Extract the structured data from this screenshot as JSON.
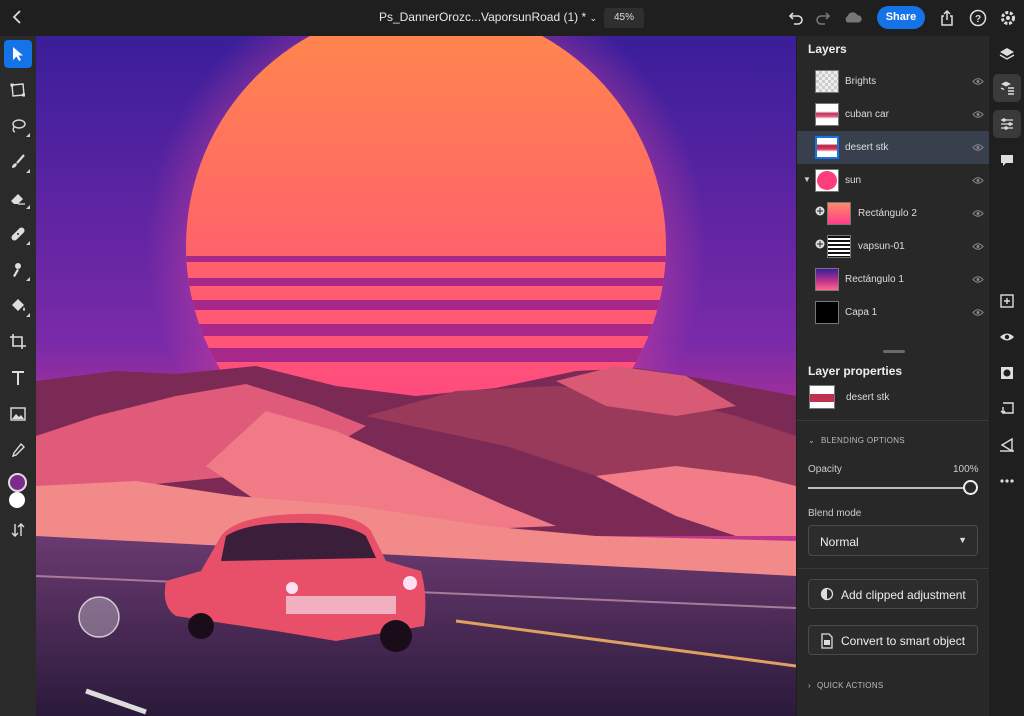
{
  "header": {
    "document_title": "Ps_DannerOrozc...VaporsunRoad (1) *",
    "zoom": "45%",
    "share_label": "Share"
  },
  "colors": {
    "accent": "#1473e6",
    "foreground_color": "#7d2a8c",
    "background_color": "#ffffff"
  },
  "toolbar": {
    "tools": [
      "move-tool",
      "transform-tool",
      "lasso-tool",
      "brush-tool",
      "eraser-tool",
      "healing-tool",
      "clone-stamp-tool",
      "paint-bucket-tool",
      "crop-tool",
      "type-tool",
      "place-image-tool",
      "eyedropper-tool",
      "color-swatches",
      "swap-colors"
    ]
  },
  "layers_panel": {
    "title": "Layers",
    "layers": [
      {
        "name": "Brights"
      },
      {
        "name": "cuban car"
      },
      {
        "name": "desert stk",
        "selected": true
      },
      {
        "name": "sun",
        "group": true,
        "expanded": true
      },
      {
        "name": "Rectángulo 2"
      },
      {
        "name": "vapsun-01"
      },
      {
        "name": "Rectángulo 1"
      },
      {
        "name": "Capa 1"
      }
    ]
  },
  "layer_properties": {
    "title": "Layer properties",
    "layer_name": "desert stk",
    "blending_options_label": "BLENDING OPTIONS",
    "opacity_label": "Opacity",
    "opacity_value": "100%",
    "opacity_fraction": 1.0,
    "blend_mode_label": "Blend mode",
    "blend_mode_value": "Normal",
    "add_clipped_adjustment_label": "Add clipped adjustment",
    "convert_smart_object_label": "Convert to smart object",
    "quick_actions_label": "QUICK ACTIONS"
  },
  "right_rail": {
    "icons": [
      "layers-icon",
      "layer-properties-icon",
      "adjustments-icon",
      "comments-icon",
      "add-layer-icon",
      "visibility-icon",
      "mask-icon",
      "clip-icon",
      "fx-icon",
      "more-icon"
    ]
  }
}
